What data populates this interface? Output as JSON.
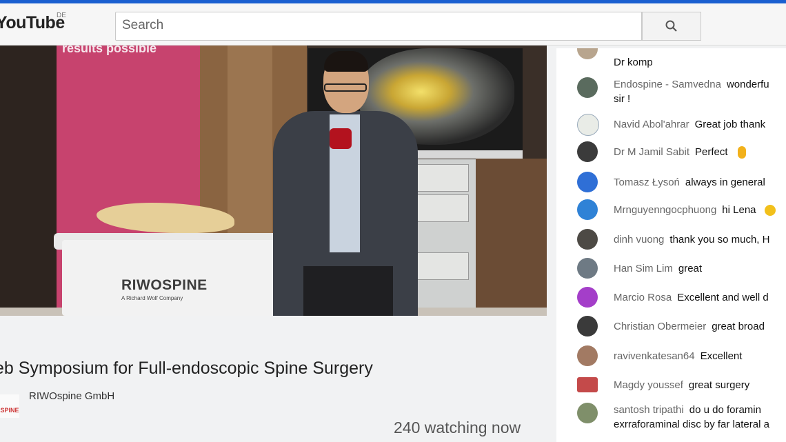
{
  "header": {
    "logo_text": "YouTube",
    "logo_region": "DE",
    "search_placeholder": "Search"
  },
  "video": {
    "banner_text": "results possible",
    "brand_name": "RIWOSPINE",
    "brand_sub": "A Richard Wolf Company"
  },
  "info": {
    "title": "eb Symposium for Full-endoscopic Spine Surgery",
    "channel_name": "RIWOspine GmbH",
    "channel_avatar_text": "ASPINE",
    "watching": "240 watching now"
  },
  "chat": {
    "messages": [
      {
        "author": "",
        "text": "Dr komp",
        "cont": "",
        "avatar_color": "#b8a58e"
      },
      {
        "author": "Endospine - Samvedna",
        "text": "wonderfu",
        "cont": "sir !",
        "avatar_color": "#5a6b5e"
      },
      {
        "author": "Navid Abol'ahrar",
        "text": "Great job thank",
        "cont": "",
        "avatar_color": "#e9ece7"
      },
      {
        "author": "Dr M Jamil Sabit",
        "text": "Perfect",
        "cont": "",
        "avatar_color": "#3b3b3b"
      },
      {
        "author": "Tomasz Łysoń",
        "text": "always in general",
        "cont": "",
        "avatar_color": "#2f6fd6"
      },
      {
        "author": "Mrnguyenngocphuong",
        "text": "hi Lena",
        "cont": "",
        "avatar_color": "#2f82d6"
      },
      {
        "author": "dinh vuong",
        "text": "thank you so much, H",
        "cont": "",
        "avatar_color": "#4d4a45"
      },
      {
        "author": "Han Sim Lim",
        "text": "great",
        "cont": "",
        "avatar_color": "#6e7a84"
      },
      {
        "author": "Marcio Rosa",
        "text": "Excellent and well d",
        "cont": "",
        "avatar_color": "#a43ec9"
      },
      {
        "author": "Christian Obermeier",
        "text": "great broad",
        "cont": "",
        "avatar_color": "#3a3a3a"
      },
      {
        "author": "ravivenkatesan64",
        "text": "Excellent",
        "cont": "",
        "avatar_color": "#a27a63"
      },
      {
        "author": "Magdy youssef",
        "text": "great surgery",
        "cont": "",
        "avatar_color": "#c44a4a"
      },
      {
        "author": "santosh tripathi",
        "text": "do u do foramin",
        "cont": "exrraforaminal disc by far lateral a",
        "avatar_color": "#7f8f6a"
      }
    ]
  }
}
